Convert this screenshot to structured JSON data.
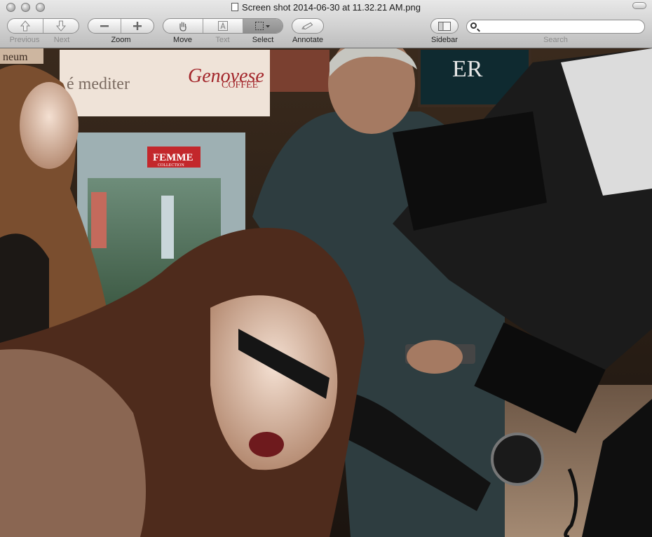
{
  "window": {
    "title": "Screen shot 2014-06-30 at 11.32.21 AM.png"
  },
  "toolbar": {
    "previous_label": "Previous",
    "next_label": "Next",
    "zoom_label": "Zoom",
    "move_label": "Move",
    "text_label": "Text",
    "select_label": "Select",
    "annotate_label": "Annotate",
    "sidebar_label": "Sidebar",
    "search_label": "Search",
    "search_value": "",
    "search_placeholder": ""
  },
  "photo": {
    "signs": {
      "museum": "neum",
      "cafe": "é mediter",
      "brand_script": "Genovese",
      "brand_word": "COFFEE",
      "femme": "FEMME",
      "femme_sub": "COLLECTION",
      "logo": "ER"
    }
  }
}
